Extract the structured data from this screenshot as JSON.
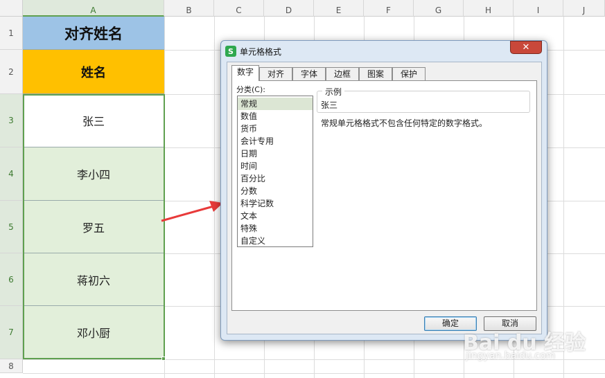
{
  "sheet": {
    "columns": [
      "A",
      "B",
      "C",
      "D",
      "E",
      "F",
      "G",
      "H",
      "I",
      "J"
    ],
    "rows": [
      "1",
      "2",
      "3",
      "4",
      "5",
      "6",
      "7",
      "8"
    ],
    "cells": {
      "a1": "对齐姓名",
      "a2": "姓名",
      "a3": "张三",
      "a4": "李小四",
      "a5": "罗五",
      "a6": "蒋初六",
      "a7": "邓小厨"
    }
  },
  "dialog": {
    "icon": "S",
    "title": "单元格格式",
    "close": "✕",
    "tabs": [
      "数字",
      "对齐",
      "字体",
      "边框",
      "图案",
      "保护"
    ],
    "category_label": "分类(C):",
    "categories": [
      "常规",
      "数值",
      "货币",
      "会计专用",
      "日期",
      "时间",
      "百分比",
      "分数",
      "科学记数",
      "文本",
      "特殊",
      "自定义"
    ],
    "sample_label": "示例",
    "sample_value": "张三",
    "description": "常规单元格格式不包含任何特定的数字格式。",
    "ok_label": "确定",
    "cancel_label": "取消"
  },
  "watermark": {
    "brand": "Bai du 经验",
    "url": "jingyan.baidu.com"
  },
  "colors": {
    "title_fill": "#9dc3e6",
    "header_fill": "#ffc000",
    "name_fill": "#e2efda",
    "selection": "#5fa04f",
    "arrow": "#e83a3a"
  }
}
